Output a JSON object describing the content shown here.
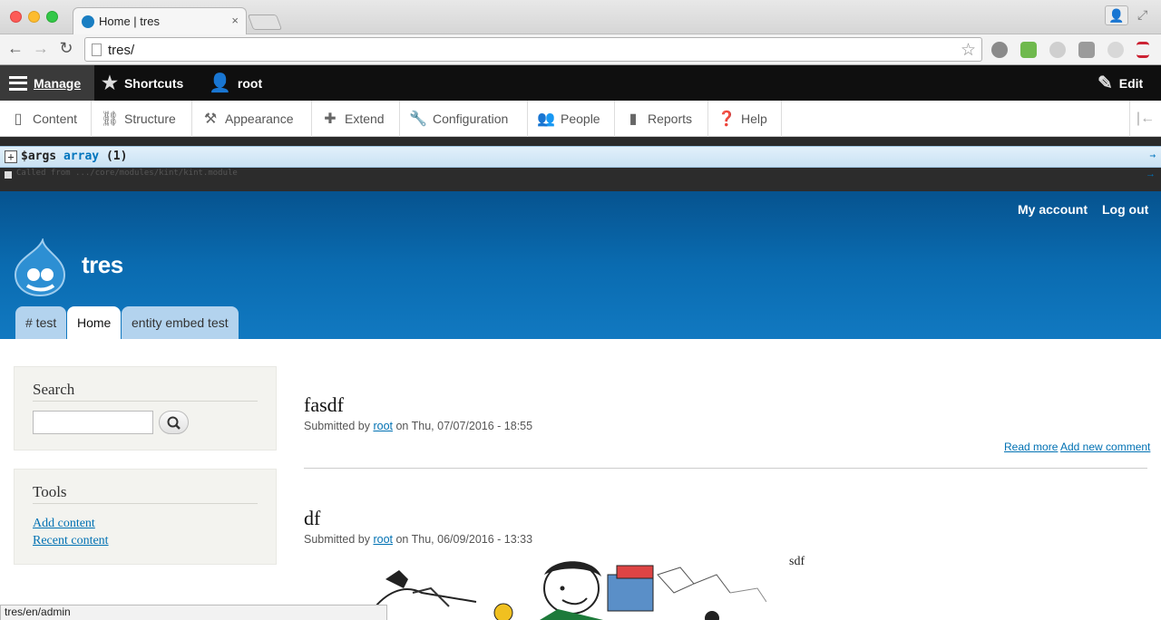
{
  "browser": {
    "tab_title": "Home | tres",
    "tab_close": "×",
    "url": "tres/",
    "back": "←",
    "forward": "→",
    "reload": "↻",
    "star": "☆",
    "profile": "👤",
    "fullscreen": "⤢"
  },
  "admin_toolbar": {
    "manage": "Manage",
    "shortcuts": "Shortcuts",
    "user": "root",
    "edit": "Edit"
  },
  "admin_tray": {
    "items": [
      {
        "label": "Content",
        "icon": "📄"
      },
      {
        "label": "Structure",
        "icon": "⛓"
      },
      {
        "label": "Appearance",
        "icon": "🔨"
      },
      {
        "label": "Extend",
        "icon": "✚"
      },
      {
        "label": "Configuration",
        "icon": "🔧"
      },
      {
        "label": "People",
        "icon": "👥"
      },
      {
        "label": "Reports",
        "icon": "📊"
      },
      {
        "label": "Help",
        "icon": "?"
      }
    ],
    "collapse": "|←"
  },
  "kint": {
    "variable": "$args",
    "type": "array",
    "count": "(1)",
    "expand": "+",
    "called_from": "Called from .../core/modules/kint/kint.module"
  },
  "site": {
    "name": "tres",
    "secondary_menu": [
      "My account",
      "Log out"
    ],
    "primary_tabs": [
      {
        "label": "# test",
        "active": false
      },
      {
        "label": "Home",
        "active": true
      },
      {
        "label": "entity embed test",
        "active": false
      }
    ]
  },
  "sidebar": {
    "search": {
      "title": "Search",
      "value": "",
      "button_icon": "search-icon"
    },
    "tools": {
      "title": "Tools",
      "links": [
        "Add content",
        "Recent content"
      ]
    }
  },
  "nodes": [
    {
      "title": "fasdf",
      "submitted_prefix": "Submitted by",
      "author": "root",
      "submitted_suffix": "on Thu, 07/07/2016 - 18:55",
      "links": [
        "Read more",
        "Add new comment"
      ]
    },
    {
      "title": "df",
      "submitted_prefix": "Submitted by",
      "author": "root",
      "submitted_suffix": "on Thu, 06/09/2016 - 13:33",
      "body": "sdf"
    }
  ],
  "status_bar": "tres/en/admin",
  "colors": {
    "header_blue": "#0a6bb0",
    "link_blue": "#0071b3",
    "admin_black": "#0f0f0f",
    "tab_inactive": "#b3d3ee"
  }
}
